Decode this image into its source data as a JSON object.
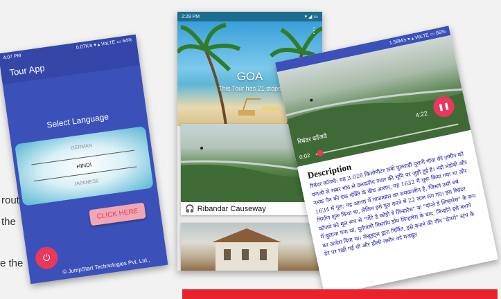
{
  "side_text": [
    "route",
    "the",
    "e the"
  ],
  "phone1": {
    "status_time": "4:07 PM",
    "status_right": "0.07K/s ▾ ▴ VoLTE ▭ 64%",
    "app_title": "Tour App",
    "select_label": "Select Language",
    "languages": [
      "GERMAN",
      "HINDI",
      "JAPANESE"
    ],
    "selected_language": "HINDI",
    "click_button": "CLICK HERE",
    "power_icon": "power-icon",
    "footer": "© JumpStart Technologies Pvt. Ltd.,"
  },
  "phone2": {
    "status_time": "2:29 PM",
    "hero_title": "GOA",
    "hero_subtitle": "This Tour has 21 stops",
    "cards": [
      {
        "label": "Ribandar Causeway",
        "icon": "headphones-icon"
      }
    ]
  },
  "phone3": {
    "status_right": "1.58M/s ▾ ▴ VoLTE ▭ 66%",
    "video_title": "रिबंदर कॉजवे",
    "duration": "4:22",
    "current_time": "0:02",
    "progress": 0.01,
    "description_heading": "Description",
    "description_text": "रिबंदर कॉजवे: यह 3.026 किलोमीटर लंबी पुलवाड़ी पुरानी गोवा की ज़मीन को पणजी से रब्बर गांव से दलदलीय ज्वार की भूमि पर जुड़ी हुई है। नदी मंडोवी और नमक पैन की एक पंक्ति के बीच आराम, यह 1632 में शुरू किया गया था और 1634 में पूरा; यह आगरा में ताजमहल का समकालीन है, जिसने उसी वर्ष निर्माण शुरू किया था, लेकिन इसे पूरा करने में 22 साल लग गए। इस रिबंदर कॉजवे को मूल रूप से \"पोंटे डे कोंडी डे लिन्हारेस\" या \"पोन्ते डे लिन्हारेस\" के रूप में बुलाया गया था, पुर्तगाली विसरॉय डोम लिन्हारेस के बाद, जिन्होंने इसे बनाने का आदेश दिया था। जेसुइट्स द्वारा निर्मित, इसे बनाने की नींव \"ढेमरों\" स्टंप के ढेर पर रखी गई थी और ढीली जमीन को मजबूत"
  }
}
